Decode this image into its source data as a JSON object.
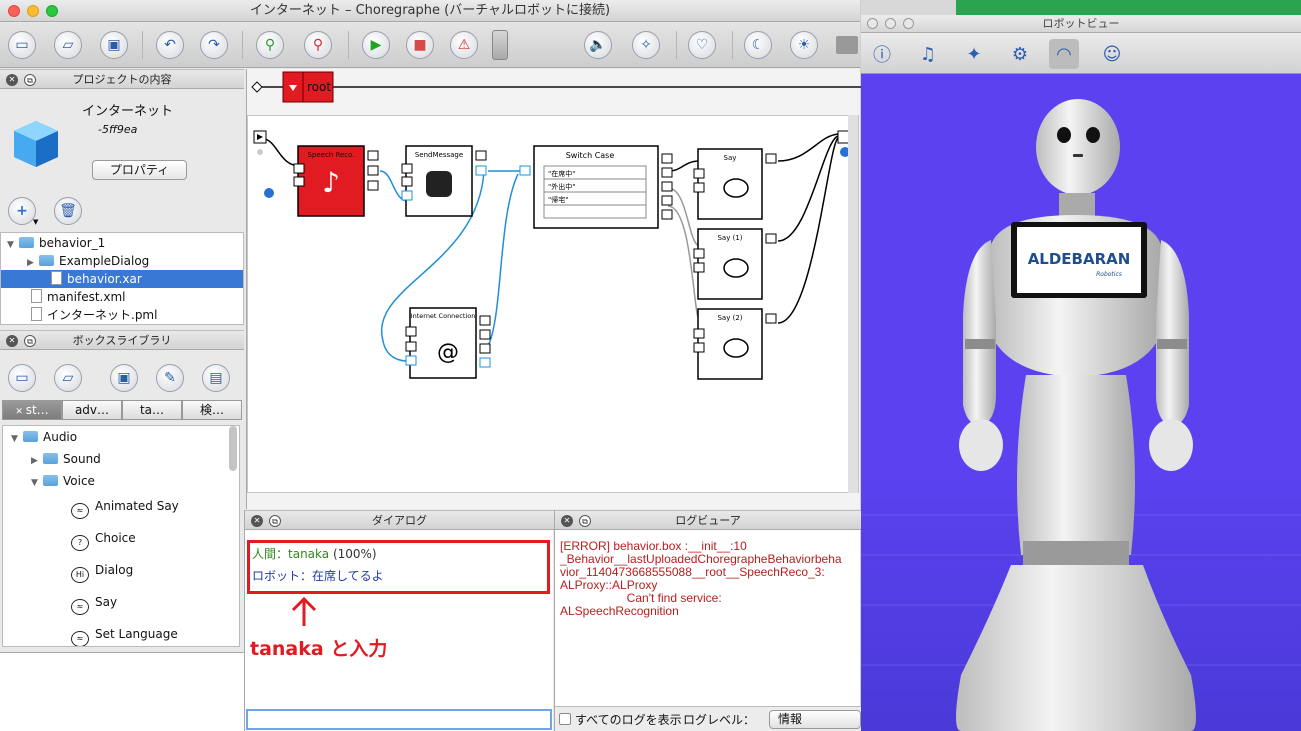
{
  "window": {
    "title": "インターネット – Choregraphe (バーチャルロボットに接続)"
  },
  "project": {
    "panel_title": "プロジェクトの内容",
    "name": "インターネット",
    "id": "-5ff9ea",
    "properties_label": "プロパティ",
    "tree": [
      {
        "label": "behavior_1",
        "type": "folder",
        "indent": 0,
        "expanded": true
      },
      {
        "label": "ExampleDialog",
        "type": "folder",
        "indent": 1,
        "expanded": false
      },
      {
        "label": "behavior.xar",
        "type": "file",
        "indent": 2,
        "selected": true
      },
      {
        "label": "manifest.xml",
        "type": "file",
        "indent": 1
      },
      {
        "label": "インターネット.pml",
        "type": "file",
        "indent": 1
      }
    ]
  },
  "library": {
    "panel_title": "ボックスライブラリ",
    "tabs": [
      "st…",
      "adv…",
      "ta…",
      "検…"
    ],
    "tree": [
      {
        "label": "Audio",
        "type": "folder",
        "indent": 0,
        "expanded": true
      },
      {
        "label": "Sound",
        "type": "folder",
        "indent": 1
      },
      {
        "label": "Voice",
        "type": "folder",
        "indent": 1,
        "expanded": true
      },
      {
        "label": "Animated Say",
        "type": "box",
        "indent": 2
      },
      {
        "label": "Choice",
        "type": "box",
        "indent": 2
      },
      {
        "label": "Dialog",
        "type": "box",
        "indent": 2
      },
      {
        "label": "Say",
        "type": "box",
        "indent": 2
      },
      {
        "label": "Set Language",
        "type": "box",
        "indent": 2
      }
    ]
  },
  "flow": {
    "breadcrumb": "root",
    "boxes": {
      "speech": "Speech Reco.",
      "send": "SendMessage",
      "switch": "Switch Case",
      "internet": "Internet Connection",
      "say": "Say",
      "say1": "Say (1)",
      "say2": "Say (2)"
    },
    "switch_cases": [
      "\"在席中\"",
      "\"外出中\"",
      "\"帰宅\""
    ]
  },
  "dialog": {
    "panel_title": "ダイアログ",
    "human_prefix": "人間：",
    "human_text": "tanaka",
    "human_conf": " (100%)",
    "robot_line": "ロボット：在席してるよ",
    "annotation": "tanaka と入力",
    "input_value": ""
  },
  "log": {
    "panel_title": "ログビューア",
    "lines": [
      "[ERROR] behavior.box :__init__:10",
      "_Behavior__lastUploadedChoregrapheBehaviorbeha",
      "vior_1140473668555088__root__SpeechReco_3:",
      "ALProxy::ALProxy",
      "                    Can't find service:",
      "ALSpeechRecognition"
    ],
    "show_all_label": "すべてのログを表示",
    "level_label": "ログレベル：",
    "level_value": "情報"
  },
  "robot_view": {
    "title": "ロボットビュー",
    "tablet_text": "ALDEBARAN",
    "tablet_sub": "Robotics"
  },
  "colors": {
    "accent_red": "#e21b23",
    "selection": "#3978d4",
    "scene_bg": "#5b41f0",
    "log_error": "#b81e1e",
    "dialog_human": "#2f8a1a",
    "dialog_robot": "#1e3ba8"
  }
}
